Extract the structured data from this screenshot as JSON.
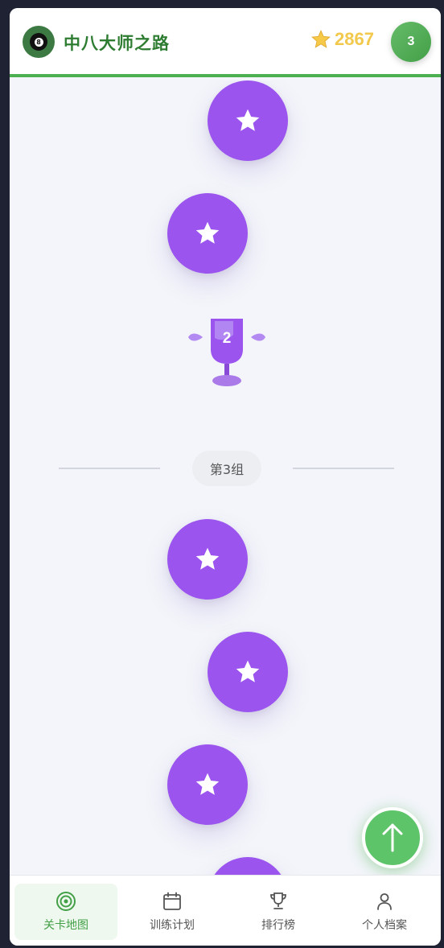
{
  "header": {
    "title": "中八大师之路",
    "logo_ball_number": "8",
    "star_count": "2867",
    "level": "3"
  },
  "map": {
    "trophy_number": "2",
    "group_label": "第3组"
  },
  "bottom_nav": {
    "items": [
      {
        "label": "关卡地图",
        "icon": "target-icon",
        "active": true
      },
      {
        "label": "训练计划",
        "icon": "calendar-icon",
        "active": false
      },
      {
        "label": "排行榜",
        "icon": "trophy-icon",
        "active": false
      },
      {
        "label": "个人档案",
        "icon": "user-icon",
        "active": false
      }
    ]
  },
  "colors": {
    "brand_green": "#4caf50",
    "node_purple": "#9b55ee",
    "star_gold": "#f2c94c"
  }
}
